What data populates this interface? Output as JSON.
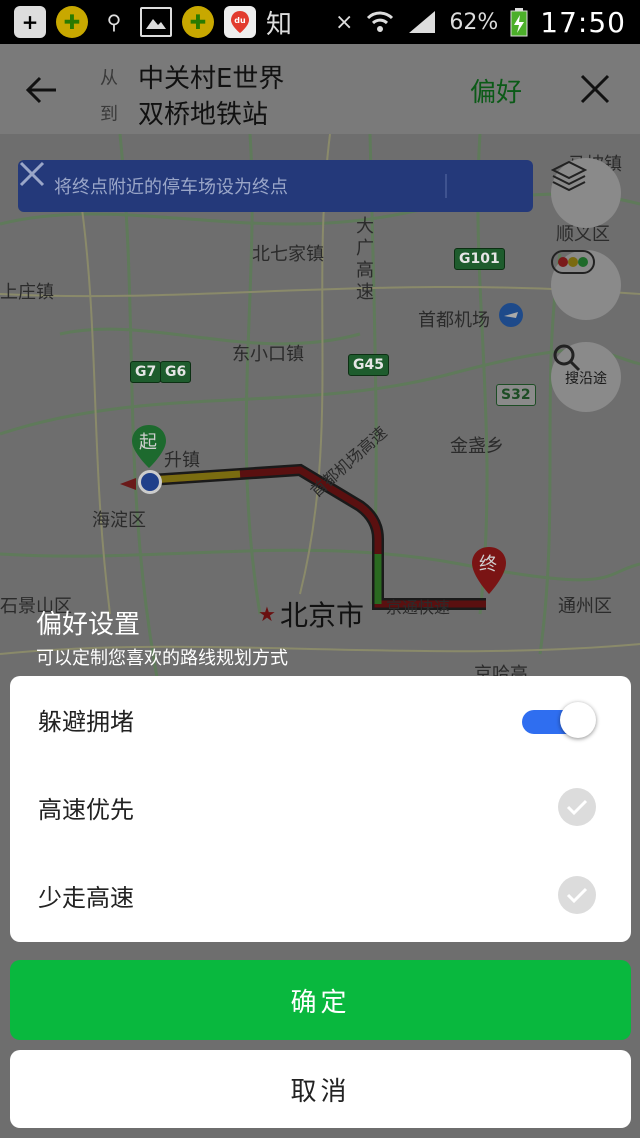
{
  "status_bar": {
    "notification_icons": [
      "add-box-icon",
      "plus-coin-icon",
      "usb-icon",
      "image-icon",
      "plus-coin-icon",
      "baidu-map-icon"
    ],
    "zhihu_label": "知",
    "battery_percent": "62%",
    "time": "17:50"
  },
  "header": {
    "from_label": "从",
    "from_value": "中关村E世界",
    "to_label": "到",
    "to_value": "双桥地铁站",
    "preference_label": "偏好"
  },
  "map": {
    "banner_text": "将终点附近的停车场设为终点",
    "search_along_label": "搜沿途",
    "start_marker": "起",
    "end_marker": "终",
    "labels": {
      "beiqijia": "北七家镇",
      "gaosu_vertical": "大广高速",
      "mapoa": "马坡镇",
      "shunyi": "顺义区",
      "shangzhuang": "上庄镇",
      "capital_airport": "首都机场",
      "dongxiaokou": "东小口镇",
      "jinzhan": "金盏乡",
      "haidian": "海淀区",
      "shengzhen": "升镇",
      "airport_expressway": "首都机场高速",
      "beijing": "北京市",
      "shijingshan": "石景山区",
      "tongzhou": "通州区",
      "jingtong": "京通快速",
      "jingha": "京哈高"
    },
    "road_tags": [
      "G101",
      "G7",
      "G6",
      "G45",
      "S32"
    ]
  },
  "preferences": {
    "title": "偏好设置",
    "subtitle": "可以定制您喜欢的路线规划方式",
    "options": [
      {
        "label": "躲避拥堵",
        "control": "toggle",
        "state": "on"
      },
      {
        "label": "高速优先",
        "control": "check",
        "state": "off"
      },
      {
        "label": "少走高速",
        "control": "check",
        "state": "off"
      }
    ],
    "confirm_label": "确定",
    "cancel_label": "取消"
  },
  "colors": {
    "accent_green": "#09b83e",
    "toggle_blue": "#2f6ef0",
    "overlay": "#6e6e6e"
  }
}
